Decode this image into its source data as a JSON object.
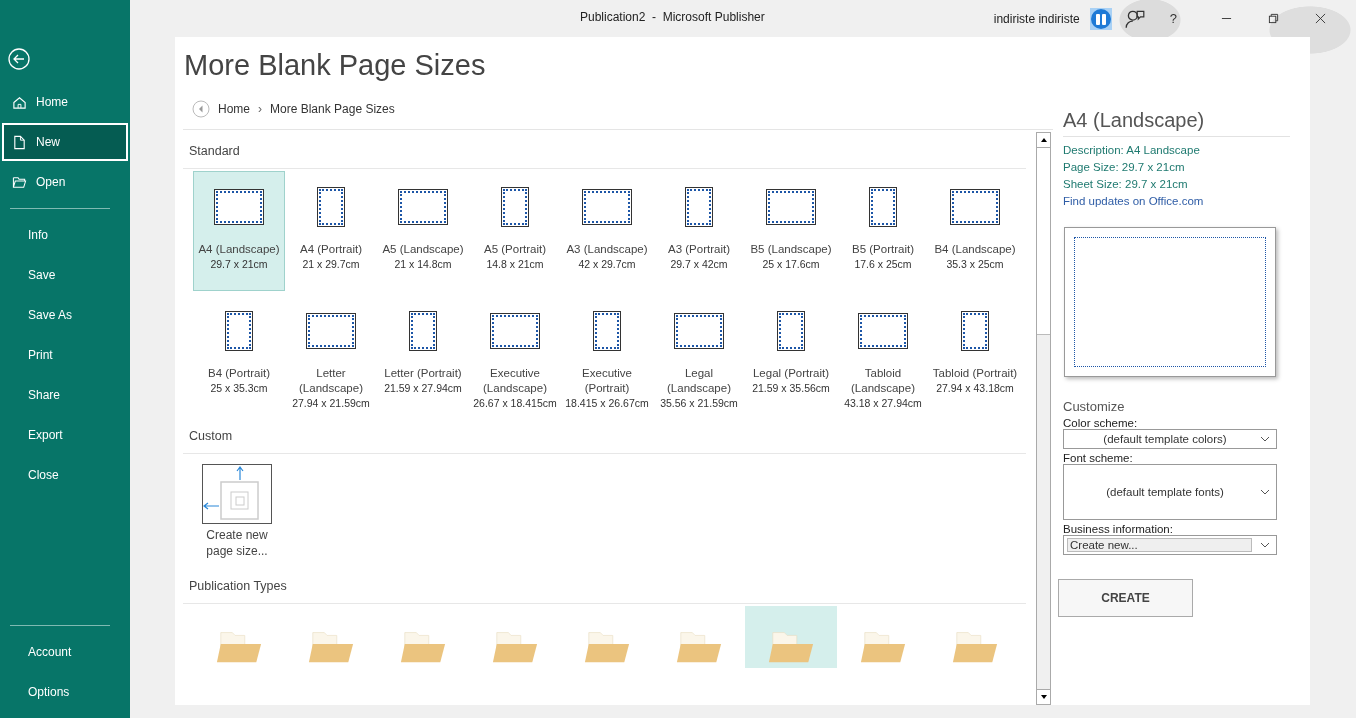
{
  "window": {
    "title": "Publication2  -  Microsoft Publisher",
    "user": "indiriste indiriste",
    "help": "?"
  },
  "sidebar": {
    "top": [
      {
        "label": "Home",
        "kind": "home",
        "selected": false
      },
      {
        "label": "New",
        "kind": "new",
        "selected": true
      },
      {
        "label": "Open",
        "kind": "open",
        "selected": false
      }
    ],
    "middle": [
      {
        "label": "Info",
        "selected": false
      },
      {
        "label": "Save",
        "selected": false
      },
      {
        "label": "Save As",
        "selected": false
      },
      {
        "label": "Print",
        "selected": false
      },
      {
        "label": "Share",
        "selected": false
      },
      {
        "label": "Export",
        "selected": false
      },
      {
        "label": "Close",
        "selected": false
      }
    ],
    "bottom": [
      {
        "label": "Account",
        "selected": false
      },
      {
        "label": "Options",
        "selected": false
      }
    ]
  },
  "heading": "More Blank Page Sizes",
  "breadcrumb": [
    "Home",
    "More Blank Page Sizes"
  ],
  "breadcrumb_separator": "›",
  "sections": {
    "standard": "Standard",
    "custom": "Custom",
    "publication_types": "Publication Types"
  },
  "page_sizes": [
    {
      "label": "A4 (Landscape)",
      "size": "29.7 x 21cm",
      "kind": "landscape",
      "selected": true
    },
    {
      "label": "A4 (Portrait)",
      "size": "21 x 29.7cm",
      "kind": "portrait",
      "selected": false
    },
    {
      "label": "A5 (Landscape)",
      "size": "21 x 14.8cm",
      "kind": "landscape",
      "selected": false
    },
    {
      "label": "A5 (Portrait)",
      "size": "14.8 x 21cm",
      "kind": "portrait",
      "selected": false
    },
    {
      "label": "A3 (Landscape)",
      "size": "42 x 29.7cm",
      "kind": "landscape",
      "selected": false
    },
    {
      "label": "A3 (Portrait)",
      "size": "29.7 x 42cm",
      "kind": "portrait",
      "selected": false
    },
    {
      "label": "B5 (Landscape)",
      "size": "25 x 17.6cm",
      "kind": "landscape",
      "selected": false
    },
    {
      "label": "B5 (Portrait)",
      "size": "17.6 x 25cm",
      "kind": "portrait",
      "selected": false
    },
    {
      "label": "B4 (Landscape)",
      "size": "35.3 x 25cm",
      "kind": "landscape",
      "selected": false
    },
    {
      "label": "B4 (Portrait)",
      "size": "25 x 35.3cm",
      "kind": "portrait",
      "selected": false
    },
    {
      "label": "Letter (Landscape)",
      "size": "27.94 x 21.59cm",
      "kind": "landscape",
      "selected": false
    },
    {
      "label": "Letter (Portrait)",
      "size": "21.59 x 27.94cm",
      "kind": "portrait",
      "selected": false
    },
    {
      "label": "Executive (Landscape)",
      "size": "26.67 x 18.415cm",
      "kind": "landscape",
      "selected": false
    },
    {
      "label": "Executive (Portrait)",
      "size": "18.415 x 26.67cm",
      "kind": "portrait",
      "selected": false
    },
    {
      "label": "Legal (Landscape)",
      "size": "35.56 x 21.59cm",
      "kind": "landscape",
      "selected": false
    },
    {
      "label": "Legal (Portrait)",
      "size": "21.59 x 35.56cm",
      "kind": "portrait",
      "selected": false
    },
    {
      "label": "Tabloid (Landscape)",
      "size": "43.18 x 27.94cm",
      "kind": "landscape",
      "selected": false
    },
    {
      "label": "Tabloid (Portrait)",
      "size": "27.94 x 43.18cm",
      "kind": "portrait",
      "selected": false
    }
  ],
  "custom_item": {
    "label": "Create new page size..."
  },
  "publication_types": [
    {
      "selected": false
    },
    {
      "selected": false
    },
    {
      "selected": false
    },
    {
      "selected": false
    },
    {
      "selected": false
    },
    {
      "selected": false
    },
    {
      "selected": true
    },
    {
      "selected": false
    },
    {
      "selected": false
    }
  ],
  "details": {
    "title": "A4 (Landscape)",
    "lines": [
      "Description: A4 Landscape",
      "Page Size: 29.7 x 21cm",
      "Sheet Size: 29.7 x 21cm"
    ],
    "link": "Find updates on Office.com"
  },
  "customize": {
    "title": "Customize",
    "fields": [
      {
        "label": "Color scheme:",
        "value": "(default template colors)",
        "kind": "centered"
      },
      {
        "label": "Font scheme:",
        "value": "(default template fonts)",
        "kind": "tall"
      },
      {
        "label": "Business information:",
        "value": "Create new...",
        "kind": "boxed"
      }
    ],
    "button": "CREATE"
  }
}
